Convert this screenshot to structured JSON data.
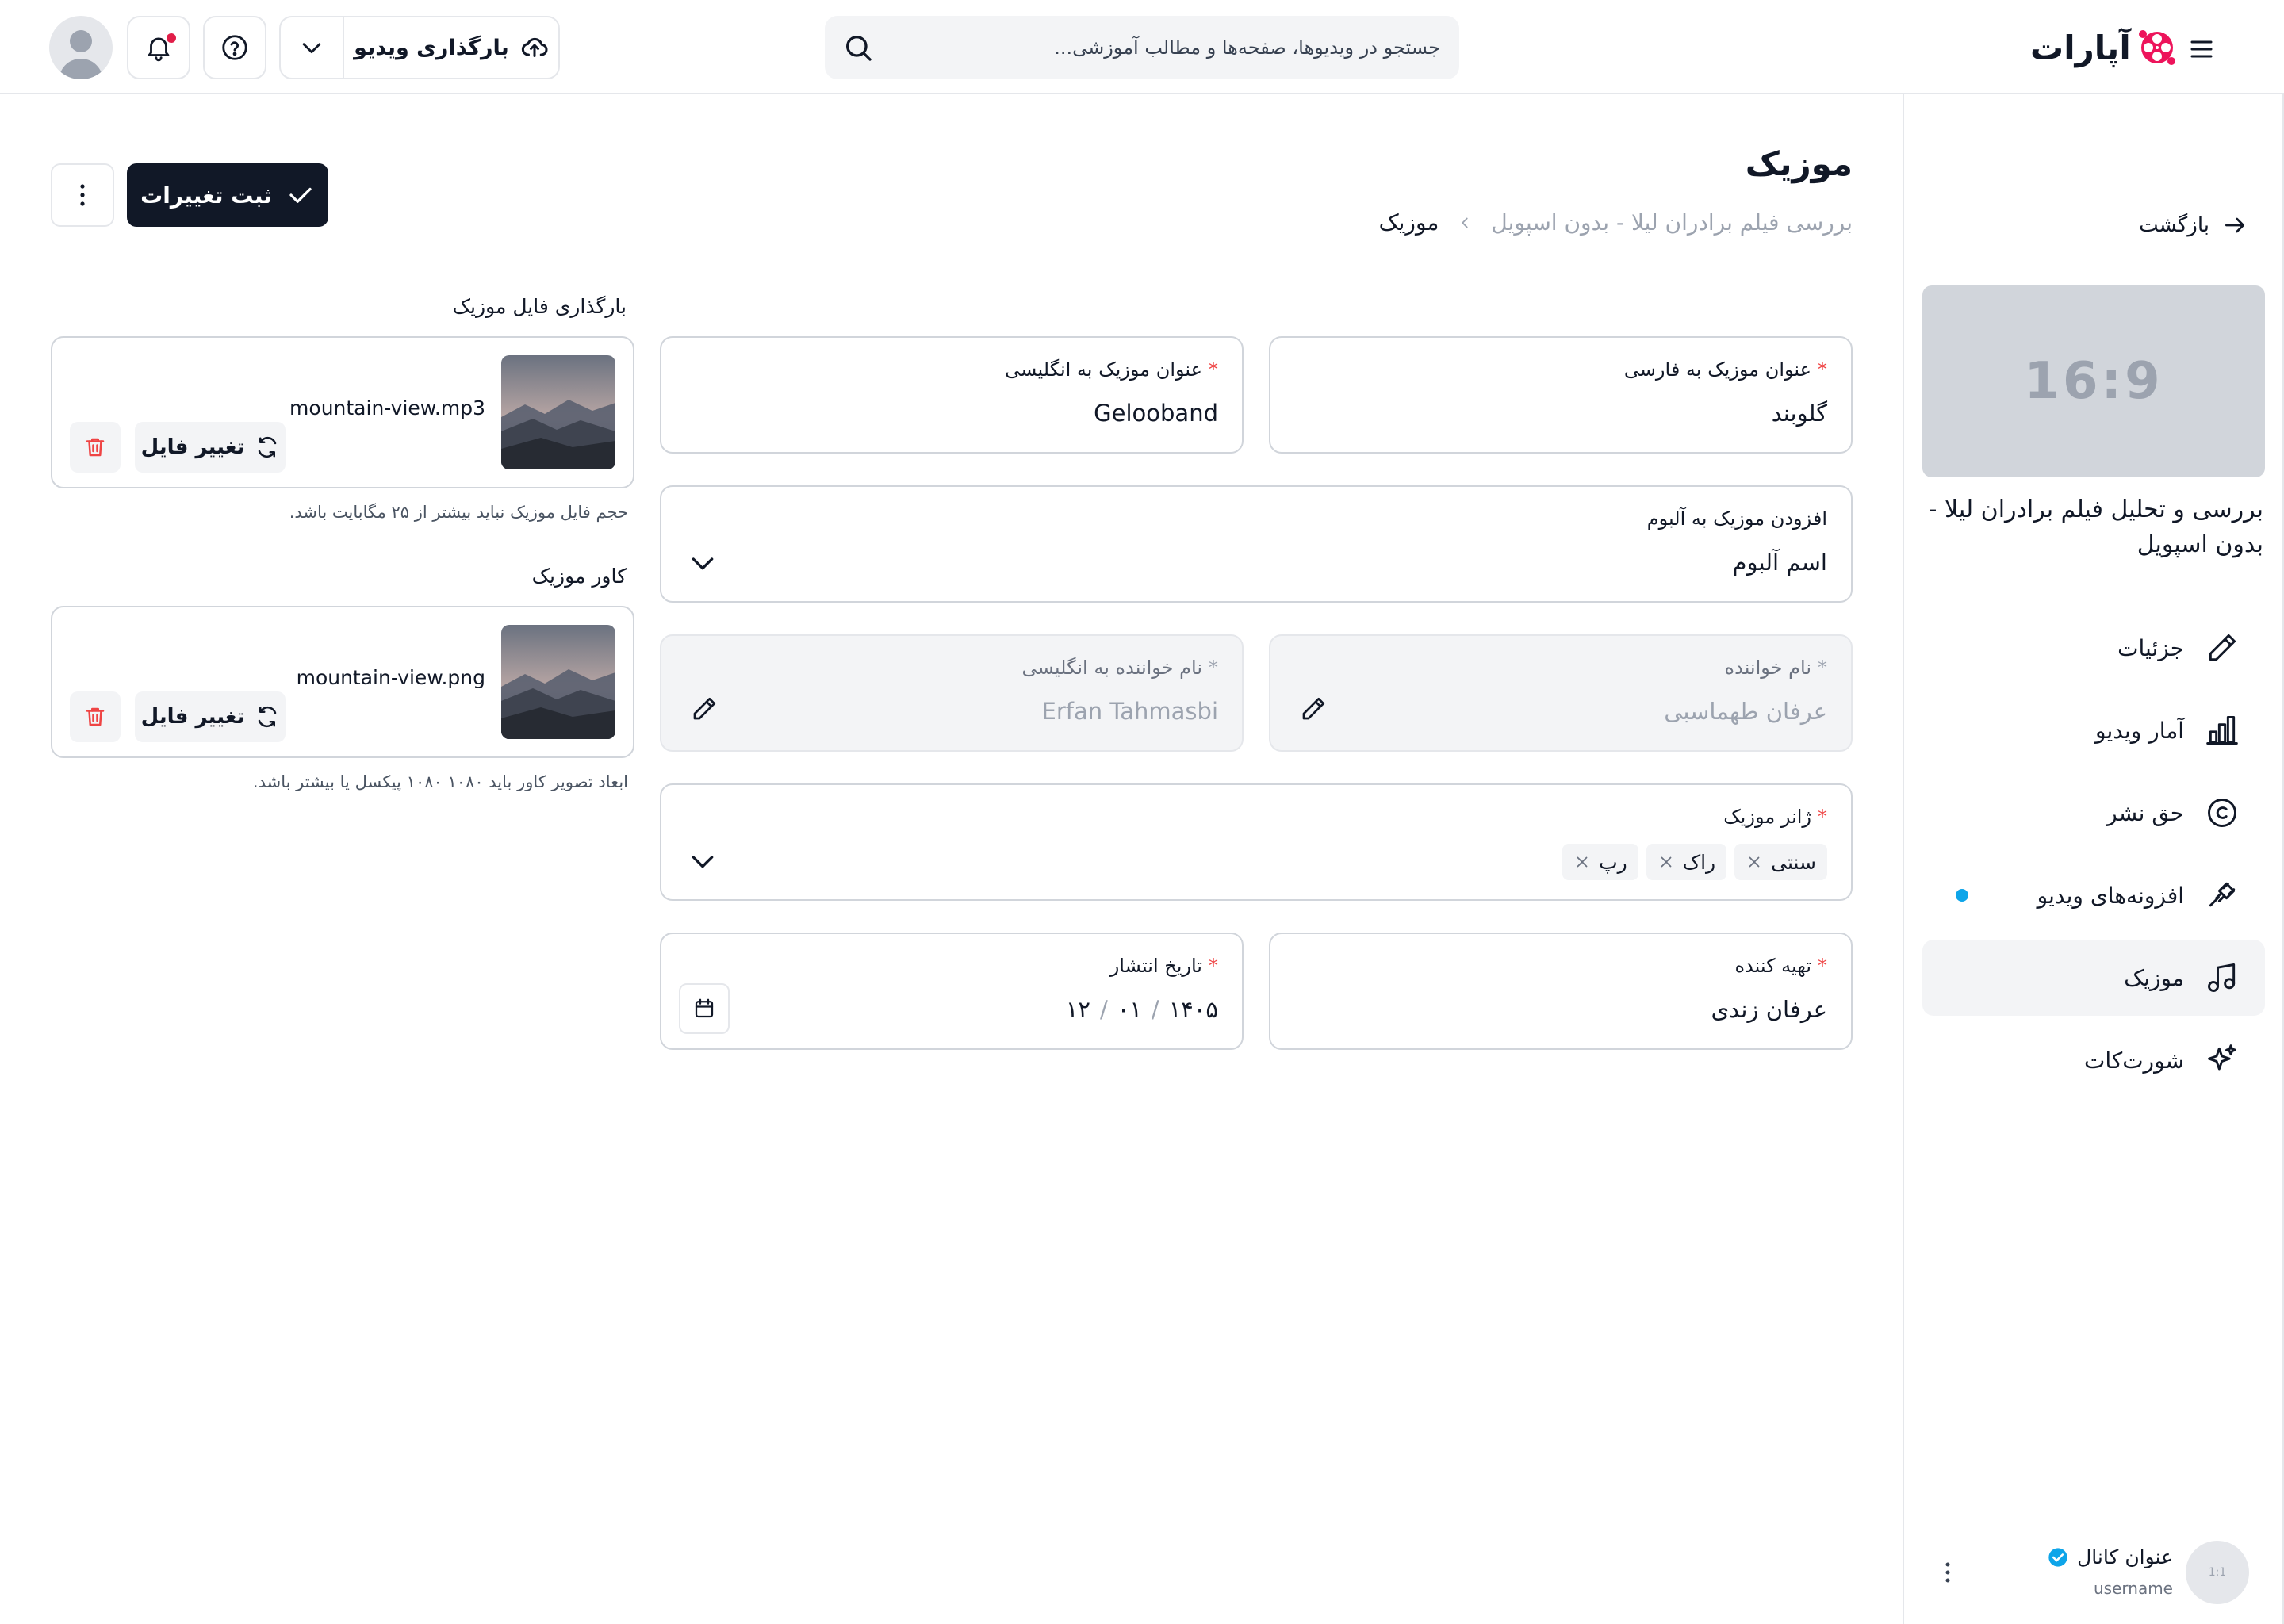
{
  "header": {
    "logo_text": "آپارات",
    "search_placeholder": "جستجو در ویدیوها، صفحه‌ها و مطالب آموزشی...",
    "upload_label": "بارگذاری ویدیو",
    "notification_dot_color": "#e11d48",
    "icons": [
      "menu-icon",
      "aparat-logo-icon",
      "search-icon",
      "upload-cloud-icon",
      "chevron-down-icon",
      "help-icon",
      "bell-icon",
      "user-avatar-icon"
    ]
  },
  "sidebar": {
    "back_label": "بازگشت",
    "thumbnail_ratio": "16:9",
    "video_title": "بررسی و تحلیل فیلم برادران لیلا - بدون اسپویل",
    "items": [
      {
        "label": "جزئیات",
        "icon": "pencil-icon",
        "active": false,
        "dot": false
      },
      {
        "label": "آمار ویدیو",
        "icon": "bar-chart-icon",
        "active": false,
        "dot": false
      },
      {
        "label": "حق نشر",
        "icon": "copyright-icon",
        "active": false,
        "dot": false
      },
      {
        "label": "افزونه‌های ویدیو",
        "icon": "plugin-icon",
        "active": false,
        "dot": true
      },
      {
        "label": "موزیک",
        "icon": "music-icon",
        "active": true,
        "dot": false
      },
      {
        "label": "شورت‌کات",
        "icon": "sparkle-icon",
        "active": false,
        "dot": false
      }
    ],
    "channel": {
      "avatar_text": "1:1",
      "name": "عنوان کانال",
      "username": "username",
      "verified_color": "#0ea5e9"
    }
  },
  "main": {
    "title": "موزیک",
    "breadcrumb": {
      "parent": "بررسی فیلم برادران لیلا - بدون اسپویل",
      "current": "موزیک"
    },
    "save_label": "ثبت تغییرات",
    "fields": {
      "title_fa": {
        "label": "عنوان موزیک به فارسی",
        "value": "گلوبند",
        "required": true
      },
      "title_en": {
        "label": "عنوان موزیک به انگلیسی",
        "value": "Gelooband",
        "required": true
      },
      "album": {
        "label": "افزودن موزیک به آلبوم",
        "value": "اسم آلبوم",
        "required": false
      },
      "singer": {
        "label": "نام خواننده",
        "value": "عرفان طهماسبی",
        "required": true,
        "disabled": true
      },
      "singer_en": {
        "label": "نام خواننده به انگلیسی",
        "value": "Erfan Tahmasbi",
        "required": true,
        "disabled": true
      },
      "genre": {
        "label": "ژانر موزیک",
        "required": true,
        "tags": [
          "سنتی",
          "راک",
          "رپ"
        ]
      },
      "producer": {
        "label": "تهیه کننده",
        "value": "عرفان زندی",
        "required": true
      },
      "release_date": {
        "label": "تاریخ انتشار",
        "day": "۱۲",
        "month": "۰۱",
        "year": "۱۴۰۵",
        "separator": "/",
        "required": true
      }
    },
    "music_upload": {
      "label": "بارگذاری فایل موزیک",
      "file_name": "mountain-view.mp3",
      "change_label": "تغییر فایل",
      "hint": "حجم فایل موزیک نباید بیشتر از ۲۵ مگابایت باشد."
    },
    "cover_upload": {
      "label": "کاور موزیک",
      "file_name": "mountain-view.png",
      "change_label": "تغییر فایل",
      "hint": "ابعاد تصویر کاور باید ۱۰۸۰ ۱۰۸۰ پیکسل یا بیشتر باشد."
    }
  },
  "colors": {
    "primary_button": "#111827",
    "required_asterisk": "#ef4444",
    "delete_icon": "#ef4444",
    "active_nav_bg": "#f3f4f6",
    "plugin_dot": "#0ea5e9"
  }
}
